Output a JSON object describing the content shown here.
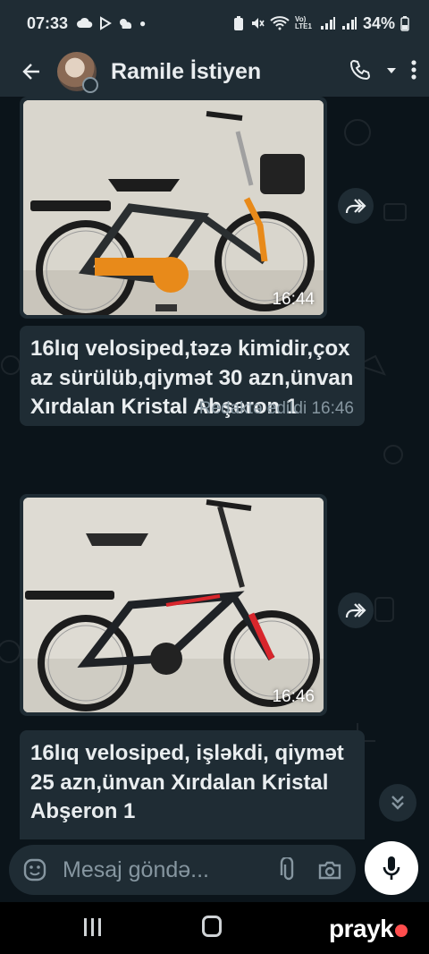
{
  "status_bar": {
    "time": "07:33",
    "battery": "34%",
    "network": "Vo) LTE1"
  },
  "header": {
    "contact_name": "Ramile İstiyen"
  },
  "messages": [
    {
      "type": "image",
      "time": "16:44",
      "depicts": "orange-black kids bicycle"
    },
    {
      "type": "text",
      "text": "16lıq velosiped,təzə kimidir,çox az sürülüb,qiymət 30 azn,ünvan Xırdalan Kristal Abşeron 1",
      "meta": "Redaktə edildi 16:46"
    },
    {
      "type": "image",
      "time": "16:46",
      "depicts": "black-red kids bicycle"
    },
    {
      "type": "text",
      "text": "16lıq velosiped, işləkdi, qiymət 25 azn,ünvan Xırdalan   Kristal Abşeron 1",
      "meta": ""
    }
  ],
  "composer": {
    "placeholder": "Mesaj göndə..."
  },
  "watermark": {
    "brand": "prayk"
  },
  "colors": {
    "background": "#0b141a",
    "bubble": "#1f2c34",
    "header": "#1f2c34",
    "meta_text": "#8696a0",
    "accent_orange": "#e88a1a",
    "accent_red": "#d8262c"
  },
  "icons": [
    "back-arrow-icon",
    "phone-icon",
    "chevron-down-icon",
    "more-vert-icon",
    "forward-icon",
    "double-chevron-down-icon",
    "emoji-icon",
    "attach-icon",
    "camera-icon",
    "mic-icon"
  ]
}
